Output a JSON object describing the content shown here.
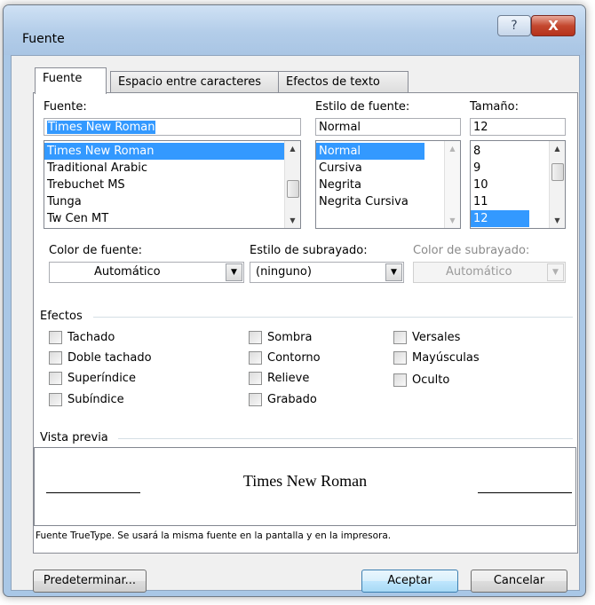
{
  "window": {
    "title": "Fuente",
    "help_glyph": "?",
    "close_glyph": "X"
  },
  "tabs": [
    {
      "label": "Fuente",
      "active": true
    },
    {
      "label": "Espacio entre caracteres",
      "active": false
    },
    {
      "label": "Efectos de texto",
      "active": false
    }
  ],
  "font": {
    "label": "Fuente:",
    "value": "Times New Roman",
    "items": [
      "Times New Roman",
      "Traditional Arabic",
      "Trebuchet MS",
      "Tunga",
      "Tw Cen MT"
    ],
    "selected_index": 0
  },
  "style": {
    "label": "Estilo de fuente:",
    "value": "Normal",
    "items": [
      "Normal",
      "Cursiva",
      "Negrita",
      "Negrita Cursiva"
    ],
    "selected_index": 0
  },
  "size": {
    "label": "Tamaño:",
    "value": "12",
    "items": [
      "8",
      "9",
      "10",
      "11",
      "12"
    ],
    "selected_index": 4
  },
  "font_color": {
    "label": "Color de fuente:",
    "value": "Automático"
  },
  "underline_style": {
    "label": "Estilo de subrayado:",
    "value": "(ninguno)"
  },
  "underline_color": {
    "label": "Color de subrayado:",
    "value": "Automático",
    "disabled": true
  },
  "effects": {
    "label": "Efectos",
    "col1": [
      "Tachado",
      "Doble tachado",
      "Superíndice",
      "Subíndice"
    ],
    "col2": [
      "Sombra",
      "Contorno",
      "Relieve",
      "Grabado"
    ],
    "col3": [
      "Versales",
      "Mayúsculas",
      "Oculto"
    ]
  },
  "preview": {
    "label": "Vista previa",
    "text": "Times New Roman",
    "note": "Fuente TrueType. Se usará la misma fuente en la pantalla y en la impresora."
  },
  "buttons": {
    "default": "Predeterminar...",
    "ok": "Aceptar",
    "cancel": "Cancelar"
  }
}
